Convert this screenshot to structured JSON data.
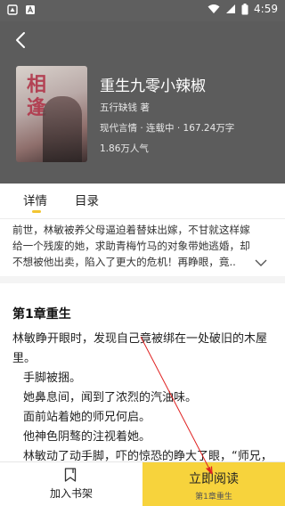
{
  "status_bar": {
    "time": "4:59"
  },
  "book": {
    "title": "重生九零小辣椒",
    "author": "五行缺钱 著",
    "meta": "现代言情 · 连载中 · 167.24万字",
    "popularity": "1.86万人气",
    "cover_text": "相逢"
  },
  "tabs": [
    {
      "label": "详情",
      "active": true
    },
    {
      "label": "目录",
      "active": false
    }
  ],
  "synopsis": {
    "lines": [
      "前世，林敏被养父母逼迫着替妹出嫁，不甘就这样嫁",
      "给一个残废的她，求助青梅竹马的对象带她逃婚，却",
      "不想被他出卖，陷入了更大的危机！再睁眼，竟.."
    ]
  },
  "chapter": {
    "title": "第1章重生",
    "paragraphs": [
      "林敏睁开眼时，发现自己竟被绑在一处破旧的木屋里。",
      "手脚被捆。",
      "她鼻息间，闻到了浓烈的汽油味。",
      "面前站着她的师兄何启。",
      "他神色阴骜的注视着她。",
      "林敏动了动手脚，吓的惊恐的睁大了眼，“师兄，这是哪里？谁绑的我？”"
    ]
  },
  "bottom_bar": {
    "shelf_label": "加入书架",
    "read_label": "立即阅读",
    "read_sub": "第1章重生"
  },
  "colors": {
    "header_bg": "#5c5c5c",
    "accent": "#f7d33c",
    "annotation": "#e02020"
  }
}
